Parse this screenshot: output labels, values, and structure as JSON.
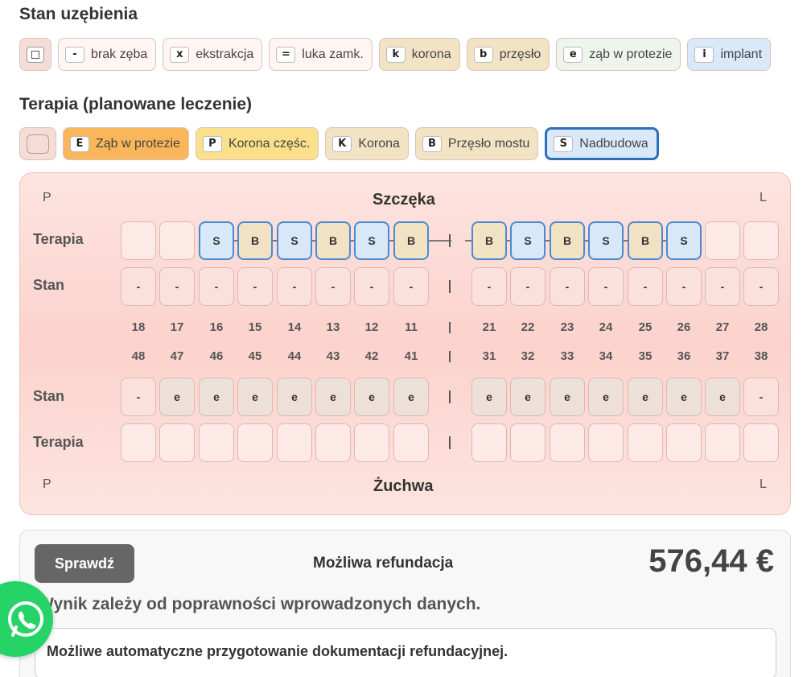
{
  "stan": {
    "title": "Stan uzębienia",
    "legend": [
      {
        "key": "",
        "label": "",
        "kind": "square",
        "bg": "#f4ddd6"
      },
      {
        "key": "-",
        "label": "brak zęba",
        "bg": "#fff5f3"
      },
      {
        "key": "x",
        "label": "ekstrakcja",
        "bg": "#fff5f3"
      },
      {
        "key": "=",
        "label": "luka zamk.",
        "bg": "#fff5f3"
      },
      {
        "key": "k",
        "label": "korona",
        "bg": "#f2e3c5"
      },
      {
        "key": "b",
        "label": "przęsło",
        "bg": "#f2e3c5"
      },
      {
        "key": "e",
        "label": "ząb w protezie",
        "bg": "#eef5ec"
      },
      {
        "key": "i",
        "label": "implant",
        "bg": "#d9e9f9"
      }
    ]
  },
  "terapia": {
    "title": "Terapia (planowane leczenie)",
    "legend": [
      {
        "key": "",
        "label": "",
        "kind": "square",
        "bg": "#f4ddd6"
      },
      {
        "key": "E",
        "label": "Ząb w protezie",
        "bg": "#f9b65a"
      },
      {
        "key": "P",
        "label": "Korona częśc.",
        "bg": "#fae08a"
      },
      {
        "key": "K",
        "label": "Korona",
        "bg": "#f2e3c5"
      },
      {
        "key": "B",
        "label": "Przęsło mostu",
        "bg": "#f2e3c5"
      },
      {
        "key": "S",
        "label": "Nadbudowa",
        "bg": "#d9e9f9",
        "selected": true
      }
    ]
  },
  "chart": {
    "upper_title": "Szczęka",
    "lower_title": "Żuchwa",
    "left_side": "P",
    "right_side": "L",
    "row_labels": {
      "terapia": "Terapia",
      "stan": "Stan"
    },
    "separator": "|",
    "upper_numbers": [
      "18",
      "17",
      "16",
      "15",
      "14",
      "13",
      "12",
      "11",
      "21",
      "22",
      "23",
      "24",
      "25",
      "26",
      "27",
      "28"
    ],
    "lower_numbers": [
      "48",
      "47",
      "46",
      "45",
      "44",
      "43",
      "42",
      "41",
      "31",
      "32",
      "33",
      "34",
      "35",
      "36",
      "37",
      "38"
    ],
    "upper_terapia": [
      "",
      "",
      "S",
      "B",
      "S",
      "B",
      "S",
      "B",
      "B",
      "S",
      "B",
      "S",
      "B",
      "S",
      "",
      ""
    ],
    "upper_stan": [
      "-",
      "-",
      "-",
      "-",
      "-",
      "-",
      "-",
      "-",
      "-",
      "-",
      "-",
      "-",
      "-",
      "-",
      "-",
      "-"
    ],
    "lower_stan": [
      "-",
      "e",
      "e",
      "e",
      "e",
      "e",
      "e",
      "e",
      "e",
      "e",
      "e",
      "e",
      "e",
      "e",
      "e",
      "-"
    ],
    "lower_terapia": [
      "",
      "",
      "",
      "",
      "",
      "",
      "",
      "",
      "",
      "",
      "",
      "",
      "",
      "",
      "",
      ""
    ]
  },
  "result": {
    "check_label": "Sprawdź",
    "refund_label": "Możliwa refundacja",
    "refund_value": "576,44 €",
    "note": "Wynik zależy od poprawności wprowadzonych danych.",
    "doc_text": "Możliwe automatyczne przygotowanie dokumentacji refundacyjnej."
  }
}
